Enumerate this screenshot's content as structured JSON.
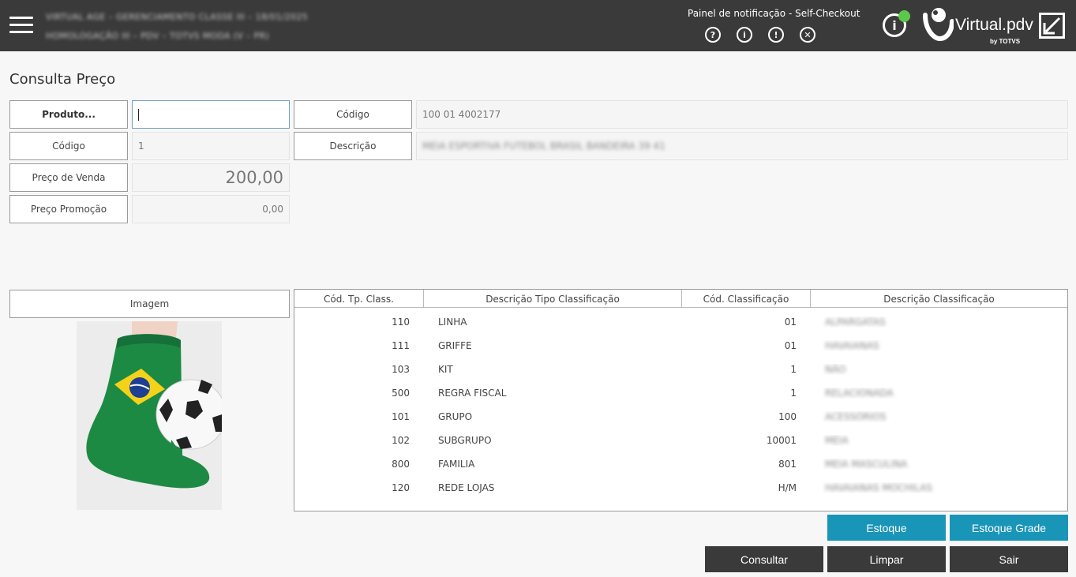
{
  "header": {
    "menu_icon": "hamburger-menu-icon",
    "info_line1": "VIRTUAL AGE – GERENCIAMENTO CLASSE III – 18/01/2025",
    "info_line2": "HOMOLOGAÇÃO III – PDV – TOTVS MODA (V – PR)",
    "notification_title": "Painel de notificação - Self-Checkout",
    "notification_icons": [
      {
        "name": "help-icon",
        "glyph": "?"
      },
      {
        "name": "info-icon",
        "glyph": "i"
      },
      {
        "name": "alert-icon",
        "glyph": "!"
      },
      {
        "name": "close-circle-icon",
        "glyph": "✕"
      }
    ],
    "status_info_glyph": "i",
    "status_color": "#5cc84b",
    "brand": "Virtual.pdv",
    "brand_by": "by TOTVS"
  },
  "page": {
    "title": "Consulta Preço"
  },
  "form": {
    "produto_label": "Produto...",
    "produto_value": "",
    "codigo_label": "Código",
    "codigo_value": "1",
    "preco_venda_label": "Preço de Venda",
    "preco_venda_value": "200,00",
    "preco_promocao_label": "Preço Promoção",
    "preco_promocao_value": "0,00",
    "codigo_barra_label": "Código",
    "codigo_barra_value": "100 01 4002177",
    "descricao_label": "Descrição",
    "descricao_value": "MEIA ESPORTIVA FUTEBOL BRASIL BANDEIRA 39 41"
  },
  "image": {
    "label": "Imagem"
  },
  "table": {
    "headers": [
      "Cód. Tp. Class.",
      "Descrição Tipo Classificação",
      "Cód. Classificação",
      "Descrição Classificação"
    ],
    "rows": [
      [
        "110",
        "LINHA",
        "01",
        "ALPARGATAS"
      ],
      [
        "111",
        "GRIFFE",
        "01",
        "HAVAIANAS"
      ],
      [
        "103",
        "KIT",
        "1",
        "NÃO"
      ],
      [
        "500",
        "REGRA FISCAL",
        "1",
        "RELACIONADA"
      ],
      [
        "101",
        "GRUPO",
        "100",
        "ACESSÓRIOS"
      ],
      [
        "102",
        "SUBGRUPO",
        "10001",
        "MEIA"
      ],
      [
        "800",
        "FAMILIA",
        "801",
        "MEIA MASCULINA"
      ],
      [
        "120",
        "REDE LOJAS",
        "H/M",
        "HAVAIANAS MOCHILAS"
      ]
    ]
  },
  "buttons": {
    "estoque": "Estoque",
    "estoque_grade": "Estoque Grade",
    "consultar": "Consultar",
    "limpar": "Limpar",
    "sair": "Sair"
  },
  "colors": {
    "header_bg": "#3a3a3a",
    "accent_blue": "#1995b8",
    "dark_button": "#3a3a3a"
  }
}
